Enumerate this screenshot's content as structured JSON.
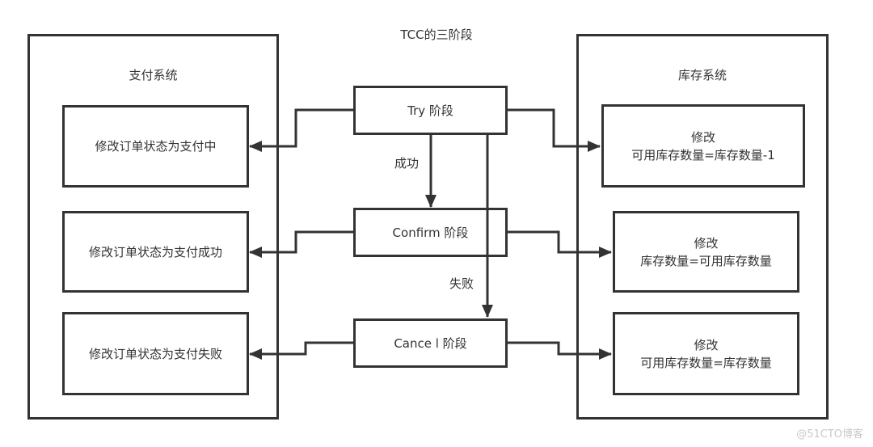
{
  "title": "TCC的三阶段",
  "left_system": {
    "title": "支付系统",
    "items": [
      {
        "text": "修改订单状态为支付中"
      },
      {
        "text": "修改订单状态为支付成功"
      },
      {
        "text": "修改订单状态为支付失败"
      }
    ]
  },
  "right_system": {
    "title": "库存系统",
    "items": [
      {
        "line1": "修改",
        "line2": "可用库存数量=库存数量-1"
      },
      {
        "line1": "修改",
        "line2": "库存数量=可用库存数量"
      },
      {
        "line1": "修改",
        "line2": "可用库存数量=库存数量"
      }
    ]
  },
  "phases": [
    {
      "label": "Try 阶段"
    },
    {
      "label": "Confirm 阶段"
    },
    {
      "label": "Cance l 阶段"
    }
  ],
  "edges": {
    "success_label": "成功",
    "failure_label": "失败"
  },
  "watermark": "@51CTO博客",
  "colors": {
    "stroke": "#333333",
    "text": "#333333",
    "background": "#ffffff",
    "watermark": "#c8c8c8"
  }
}
